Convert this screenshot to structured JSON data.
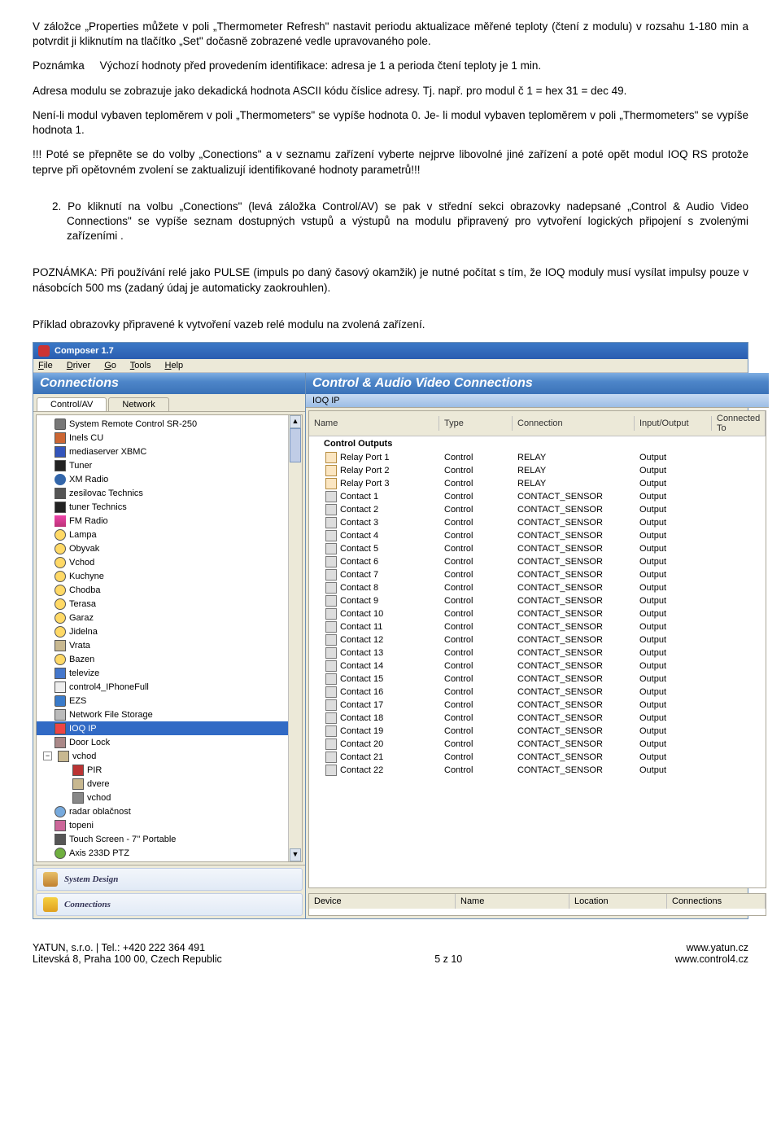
{
  "para1": "V záložce „Properties můžete v poli „Thermometer Refresh\" nastavit periodu aktualizace měřené teploty (čtení z modulu) v rozsahu 1-180 min a potvrdit ji kliknutím na tlačítko „Set\" dočasně zobrazené vedle upravovaného pole.",
  "para2_label": "Poznámka",
  "para2": "Výchozí hodnoty před provedením identifikace: adresa je 1 a perioda čtení teploty je 1 min.",
  "para3": "Adresa modulu se zobrazuje jako dekadická hodnota ASCII kódu číslice adresy. Tj. např. pro modul č 1 = hex 31 = dec 49.",
  "para4": "Není-li modul vybaven teploměrem v poli „Thermometers\" se vypíše hodnota 0. Je- li modul vybaven teploměrem v poli „Thermometers\" se vypíše hodnota 1.",
  "para5": "!!! Poté se přepněte se do volby „Conections\" a v seznamu zařízení vyberte nejprve libovolné jiné zařízení a poté opět modul IOQ RS protože teprve při opětovném zvolení se zaktualizují identifikované hodnoty parametrů!!!",
  "para6_num": "2.",
  "para6": "Po kliknutí na volbu „Conections\" (levá záložka Control/AV) se pak v střední sekci obrazovky nadepsané „Control & Audio Video Connections\" se vypíše seznam dostupných vstupů a výstupů na modulu připravený pro vytvoření logických připojení s zvolenými zařízeními .",
  "para7": "POZNÁMKA: Při používání relé jako PULSE (impuls po daný časový okamžik) je nutné počítat s tím, že IOQ moduly musí vysílat impulsy pouze v násobcích 500 ms (zadaný údaj je automaticky zaokrouhlen).",
  "para8": "Příklad obrazovky připravené k vytvoření vazeb relé modulu na zvolená zařízení.",
  "app": {
    "title": "Composer 1.7",
    "menu": [
      "File",
      "Driver",
      "Go",
      "Tools",
      "Help"
    ],
    "left_header": "Connections",
    "right_header": "Control & Audio Video Connections",
    "tab1": "Control/AV",
    "tab2": "Network",
    "sub_header": "IOQ IP",
    "nav1": "System Design",
    "nav2": "Connections",
    "cols": {
      "name": "Name",
      "type": "Type",
      "conn": "Connection",
      "io": "Input/Output",
      "cto": "Connected To"
    },
    "section": "Control Outputs",
    "cols2": {
      "device": "Device",
      "name": "Name",
      "location": "Location",
      "conn": "Connections"
    }
  },
  "tree": [
    {
      "ico": "ico-remote",
      "label": "System Remote Control SR-250"
    },
    {
      "ico": "ico-cu",
      "label": "Inels CU"
    },
    {
      "ico": "ico-media",
      "label": "mediaserver XBMC"
    },
    {
      "ico": "ico-tuner",
      "label": "Tuner"
    },
    {
      "ico": "ico-xm",
      "label": "XM Radio"
    },
    {
      "ico": "ico-amp",
      "label": "zesilovac Technics"
    },
    {
      "ico": "ico-tuner",
      "label": "tuner Technics"
    },
    {
      "ico": "ico-fm",
      "label": "FM Radio"
    },
    {
      "ico": "ico-light",
      "label": "Lampa"
    },
    {
      "ico": "ico-light",
      "label": "Obyvak"
    },
    {
      "ico": "ico-light",
      "label": "Vchod"
    },
    {
      "ico": "ico-light",
      "label": "Kuchyne"
    },
    {
      "ico": "ico-light",
      "label": "Chodba"
    },
    {
      "ico": "ico-light",
      "label": "Terasa"
    },
    {
      "ico": "ico-light",
      "label": "Garaz"
    },
    {
      "ico": "ico-light",
      "label": "Jidelna"
    },
    {
      "ico": "ico-door",
      "label": "Vrata"
    },
    {
      "ico": "ico-light",
      "label": "Bazen"
    },
    {
      "ico": "ico-tv",
      "label": "televize"
    },
    {
      "ico": "ico-phone",
      "label": "control4_IPhoneFull"
    },
    {
      "ico": "ico-shield",
      "label": "EZS"
    },
    {
      "ico": "ico-storage",
      "label": "Network File Storage"
    },
    {
      "ico": "ico-ioq",
      "label": "IOQ IP",
      "sel": true
    },
    {
      "ico": "ico-lock",
      "label": "Door Lock"
    },
    {
      "ico": "ico-door",
      "label": "vchod",
      "expand": true
    },
    {
      "ico": "ico-motion",
      "label": "PIR",
      "indent": true
    },
    {
      "ico": "ico-door",
      "label": "dvere",
      "indent": true
    },
    {
      "ico": "ico-sw",
      "label": "vchod",
      "indent": true
    },
    {
      "ico": "ico-radar",
      "label": "radar oblačnost"
    },
    {
      "ico": "ico-heat",
      "label": "topeni"
    },
    {
      "ico": "ico-touch",
      "label": "Touch Screen - 7'' Portable"
    },
    {
      "ico": "ico-cam",
      "label": "Axis 233D PTZ"
    }
  ],
  "rows": [
    {
      "ico": "ico-relay",
      "name": "Relay Port 1",
      "type": "Control",
      "conn": "RELAY",
      "io": "Output"
    },
    {
      "ico": "ico-relay",
      "name": "Relay Port 2",
      "type": "Control",
      "conn": "RELAY",
      "io": "Output"
    },
    {
      "ico": "ico-relay",
      "name": "Relay Port 3",
      "type": "Control",
      "conn": "RELAY",
      "io": "Output"
    },
    {
      "ico": "ico-contact",
      "name": "Contact 1",
      "type": "Control",
      "conn": "CONTACT_SENSOR",
      "io": "Output"
    },
    {
      "ico": "ico-contact",
      "name": "Contact 2",
      "type": "Control",
      "conn": "CONTACT_SENSOR",
      "io": "Output"
    },
    {
      "ico": "ico-contact",
      "name": "Contact 3",
      "type": "Control",
      "conn": "CONTACT_SENSOR",
      "io": "Output"
    },
    {
      "ico": "ico-contact",
      "name": "Contact 4",
      "type": "Control",
      "conn": "CONTACT_SENSOR",
      "io": "Output"
    },
    {
      "ico": "ico-contact",
      "name": "Contact 5",
      "type": "Control",
      "conn": "CONTACT_SENSOR",
      "io": "Output"
    },
    {
      "ico": "ico-contact",
      "name": "Contact 6",
      "type": "Control",
      "conn": "CONTACT_SENSOR",
      "io": "Output"
    },
    {
      "ico": "ico-contact",
      "name": "Contact 7",
      "type": "Control",
      "conn": "CONTACT_SENSOR",
      "io": "Output"
    },
    {
      "ico": "ico-contact",
      "name": "Contact 8",
      "type": "Control",
      "conn": "CONTACT_SENSOR",
      "io": "Output"
    },
    {
      "ico": "ico-contact",
      "name": "Contact 9",
      "type": "Control",
      "conn": "CONTACT_SENSOR",
      "io": "Output"
    },
    {
      "ico": "ico-contact",
      "name": "Contact 10",
      "type": "Control",
      "conn": "CONTACT_SENSOR",
      "io": "Output"
    },
    {
      "ico": "ico-contact",
      "name": "Contact 11",
      "type": "Control",
      "conn": "CONTACT_SENSOR",
      "io": "Output"
    },
    {
      "ico": "ico-contact",
      "name": "Contact 12",
      "type": "Control",
      "conn": "CONTACT_SENSOR",
      "io": "Output"
    },
    {
      "ico": "ico-contact",
      "name": "Contact 13",
      "type": "Control",
      "conn": "CONTACT_SENSOR",
      "io": "Output"
    },
    {
      "ico": "ico-contact",
      "name": "Contact 14",
      "type": "Control",
      "conn": "CONTACT_SENSOR",
      "io": "Output"
    },
    {
      "ico": "ico-contact",
      "name": "Contact 15",
      "type": "Control",
      "conn": "CONTACT_SENSOR",
      "io": "Output"
    },
    {
      "ico": "ico-contact",
      "name": "Contact 16",
      "type": "Control",
      "conn": "CONTACT_SENSOR",
      "io": "Output"
    },
    {
      "ico": "ico-contact",
      "name": "Contact 17",
      "type": "Control",
      "conn": "CONTACT_SENSOR",
      "io": "Output"
    },
    {
      "ico": "ico-contact",
      "name": "Contact 18",
      "type": "Control",
      "conn": "CONTACT_SENSOR",
      "io": "Output"
    },
    {
      "ico": "ico-contact",
      "name": "Contact 19",
      "type": "Control",
      "conn": "CONTACT_SENSOR",
      "io": "Output"
    },
    {
      "ico": "ico-contact",
      "name": "Contact 20",
      "type": "Control",
      "conn": "CONTACT_SENSOR",
      "io": "Output"
    },
    {
      "ico": "ico-contact",
      "name": "Contact 21",
      "type": "Control",
      "conn": "CONTACT_SENSOR",
      "io": "Output"
    },
    {
      "ico": "ico-contact",
      "name": "Contact 22",
      "type": "Control",
      "conn": "CONTACT_SENSOR",
      "io": "Output"
    }
  ],
  "footer": {
    "l1": "YATUN, s.r.o. | Tel.: +420 222 364 491",
    "l2": "Litevská 8, Praha 100 00, Czech Republic",
    "mid": "5 z 10",
    "r1": "www.yatun.cz",
    "r2": "www.control4.cz"
  }
}
